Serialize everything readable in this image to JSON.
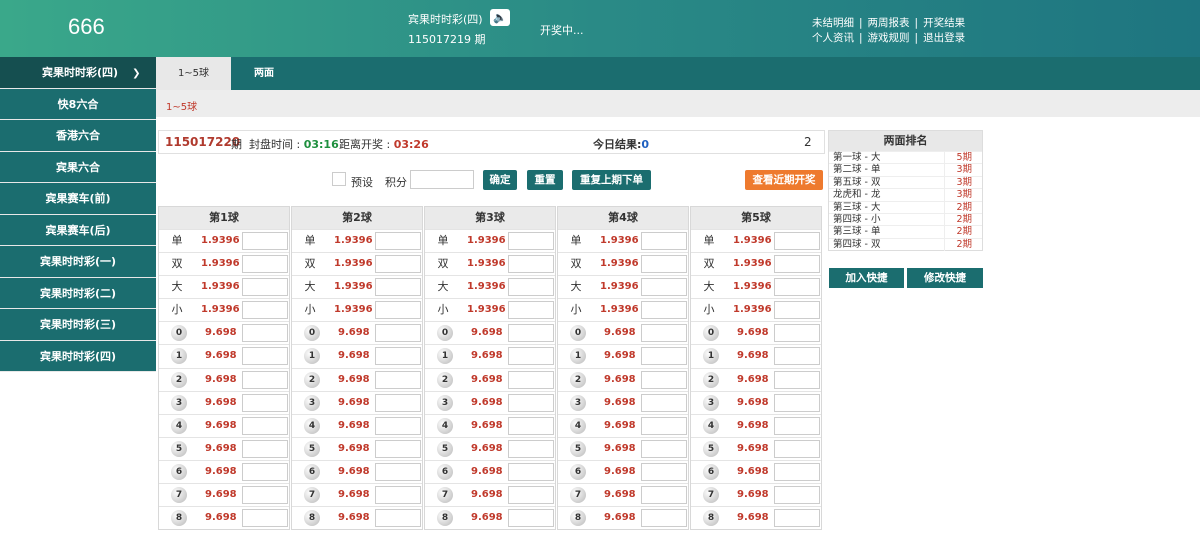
{
  "header": {
    "logo": "666",
    "game_name": "宾果时时彩(四)",
    "speaker_icon": "speaker-icon",
    "period": "115017219 期",
    "draw_status": "开奖中...",
    "links_row1": [
      "未结明细",
      "两周报表",
      "开奖结果"
    ],
    "links_row2": [
      "个人资讯",
      "游戏规则",
      "退出登录"
    ]
  },
  "sidebar": {
    "items": [
      {
        "label": "宾果时时彩(四)",
        "chevron": "chevron-down-icon"
      },
      {
        "label": "快8六合"
      },
      {
        "label": "香港六合"
      },
      {
        "label": "宾果六合"
      },
      {
        "label": "宾果赛车(前)"
      },
      {
        "label": "宾果赛车(后)"
      },
      {
        "label": "宾果时时彩(一)"
      },
      {
        "label": "宾果时时彩(二)"
      },
      {
        "label": "宾果时时彩(三)"
      },
      {
        "label": "宾果时时彩(四)"
      }
    ]
  },
  "tabs": [
    "1~5球",
    "两面"
  ],
  "subtab": "1~5球",
  "info": {
    "period": "115017220",
    "qi": "期",
    "close_label": "封盘时间 : ",
    "close_time": "03:16",
    "open_label": "距离开奖 : ",
    "open_time": "03:26",
    "today_label": "今日结果:",
    "today_value": "0",
    "right_value": "2"
  },
  "controls": {
    "preset": "预设",
    "points": "积分",
    "confirm": "确定",
    "reset": "重置",
    "repeat": "重复上期下单",
    "recent": "查看近期开奖"
  },
  "ball_columns": [
    {
      "title": "第1球"
    },
    {
      "title": "第2球"
    },
    {
      "title": "第3球"
    },
    {
      "title": "第4球"
    },
    {
      "title": "第5球"
    }
  ],
  "bet_rows": [
    {
      "label": "单",
      "odds": "1.9396"
    },
    {
      "label": "双",
      "odds": "1.9396"
    },
    {
      "label": "大",
      "odds": "1.9396"
    },
    {
      "label": "小",
      "odds": "1.9396"
    },
    {
      "ball": "0",
      "odds": "9.698"
    },
    {
      "ball": "1",
      "odds": "9.698"
    },
    {
      "ball": "2",
      "odds": "9.698"
    },
    {
      "ball": "3",
      "odds": "9.698"
    },
    {
      "ball": "4",
      "odds": "9.698"
    },
    {
      "ball": "5",
      "odds": "9.698"
    },
    {
      "ball": "6",
      "odds": "9.698"
    },
    {
      "ball": "7",
      "odds": "9.698"
    },
    {
      "ball": "8",
      "odds": "9.698"
    }
  ],
  "ranking": {
    "title": "两面排名",
    "rows": [
      {
        "k": "第一球 - 大",
        "v": "5期"
      },
      {
        "k": "第二球 - 单",
        "v": "3期"
      },
      {
        "k": "第五球 - 双",
        "v": "3期"
      },
      {
        "k": "龙虎和 - 龙",
        "v": "3期"
      },
      {
        "k": "第三球 - 大",
        "v": "2期"
      },
      {
        "k": "第四球 - 小",
        "v": "2期"
      },
      {
        "k": "第三球 - 单",
        "v": "2期"
      },
      {
        "k": "第四球 - 双",
        "v": "2期"
      }
    ],
    "add_quick": "加入快捷",
    "edit_quick": "修改快捷"
  },
  "colors": {
    "header_start": "#3aa88a",
    "header_end": "#1e7580",
    "sidebar": "#1b6d6f",
    "odds": "#c0392b",
    "close_time": "#1e8f3e",
    "orange_button": "#ee7a2e"
  }
}
